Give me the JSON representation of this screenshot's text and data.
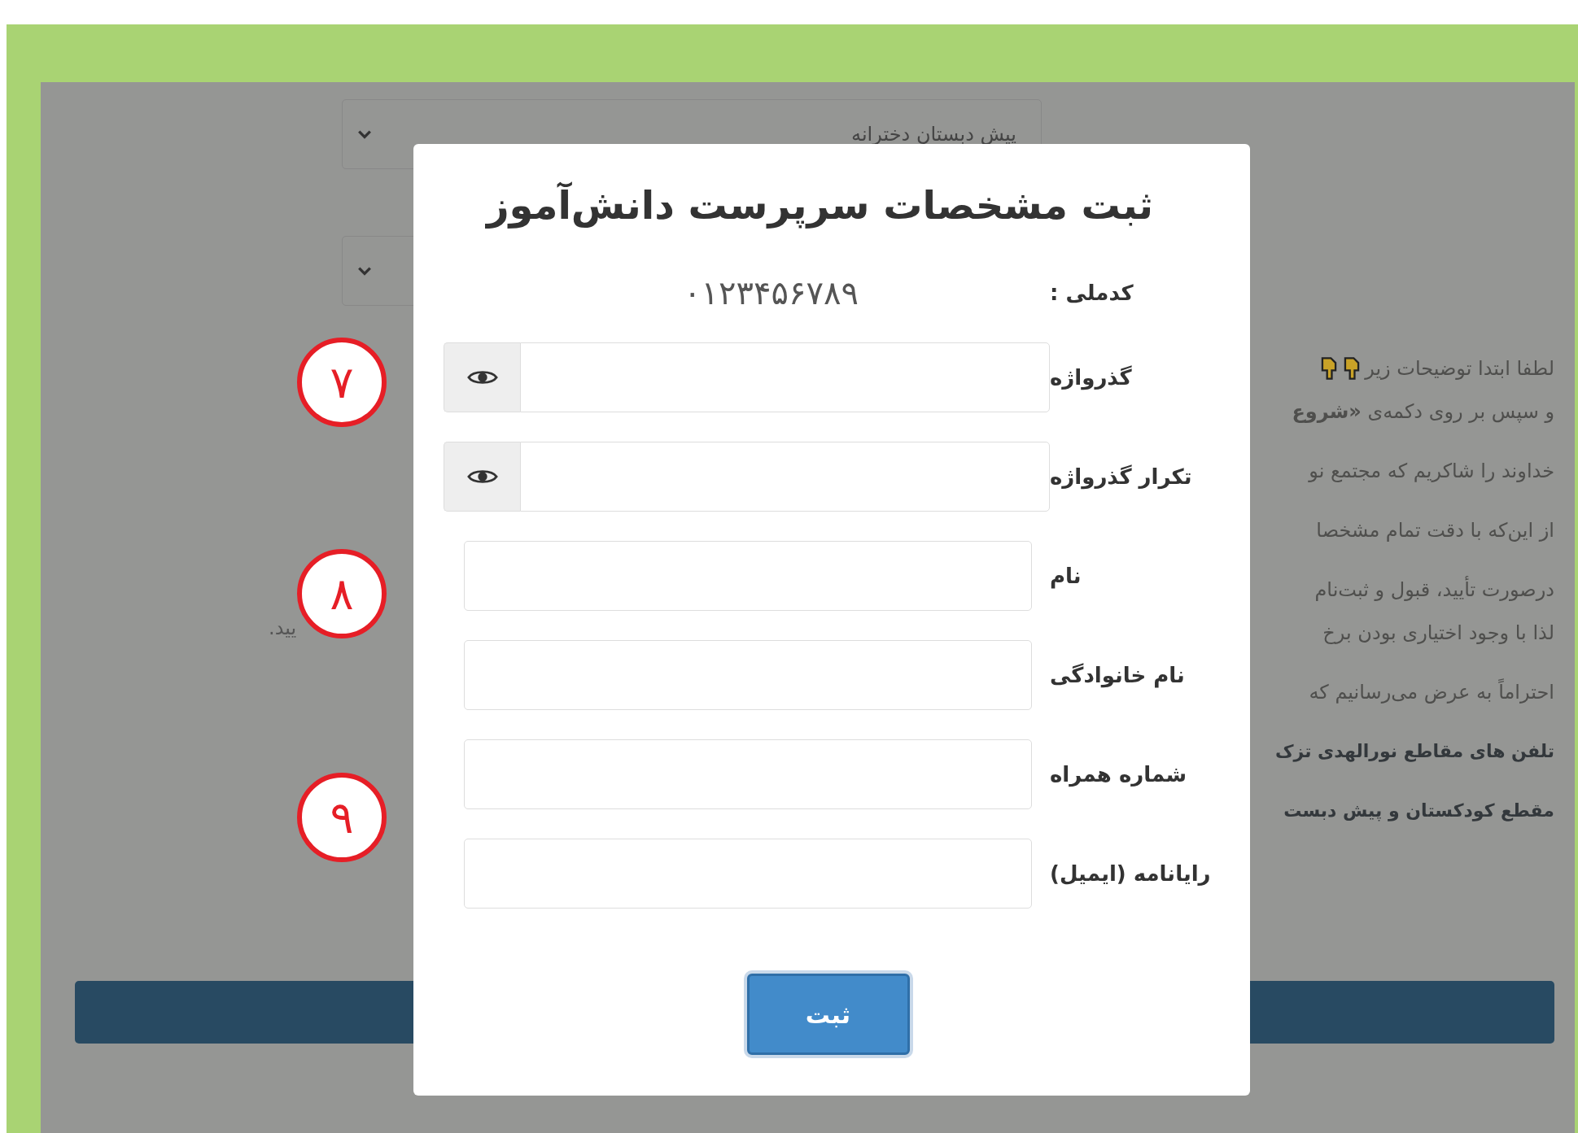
{
  "background": {
    "selects": [
      {
        "kind": "filled",
        "value": "پیش دبستان دخترانه"
      },
      {
        "kind": "empty"
      }
    ],
    "notes": [
      [
        {
          "kind": "pointer",
          "text": "لطفا ابتدا توضیحات زیر"
        },
        {
          "kind": "plain",
          "text": "و سپس بر روی دکمه‌ی **«شروع**"
        }
      ],
      [
        {
          "kind": "plain",
          "text": "خداوند را شاکریم که مجتمع نو"
        }
      ],
      [
        {
          "kind": "plain",
          "text": "از این‌که با دقت تمام مشخصا"
        }
      ],
      [
        {
          "kind": "plain",
          "text": "درصورت تأیید، قبول و ثبت‌نام"
        },
        {
          "kind": "plain",
          "text": "لذا با وجود اختیاری بودن برخ"
        }
      ],
      [
        {
          "kind": "plain",
          "text": "احتراماً به عرض می‌رسانیم که"
        }
      ],
      [
        {
          "kind": "bold",
          "text": "تلفن های مقاطع نورالهدی تزک"
        }
      ],
      [
        {
          "kind": "bold",
          "text": "مقطع کودکستان و پیش دبست"
        }
      ]
    ],
    "left_note": [
      "یید."
    ]
  },
  "modal": {
    "title": "ثبت مشخصات سرپرست دانش‌آموز",
    "national_id": {
      "label": "کدملی :",
      "value": "۰۱۲۳۴۵۶۷۸۹"
    },
    "fields": [
      {
        "label": "گذرواژه",
        "kind": "password"
      },
      {
        "label": "تکرار گذرواژه",
        "kind": "password"
      },
      {
        "label": "نام",
        "kind": "text"
      },
      {
        "label": "نام خانوادگی",
        "kind": "text"
      },
      {
        "label": "شماره همراه",
        "kind": "text"
      },
      {
        "label": "رایانامه (ایمیل)",
        "kind": "text"
      }
    ],
    "submit": "ثبت"
  },
  "annotations": [
    {
      "number": "۷"
    },
    {
      "number": "۸"
    },
    {
      "number": "۹"
    }
  ]
}
